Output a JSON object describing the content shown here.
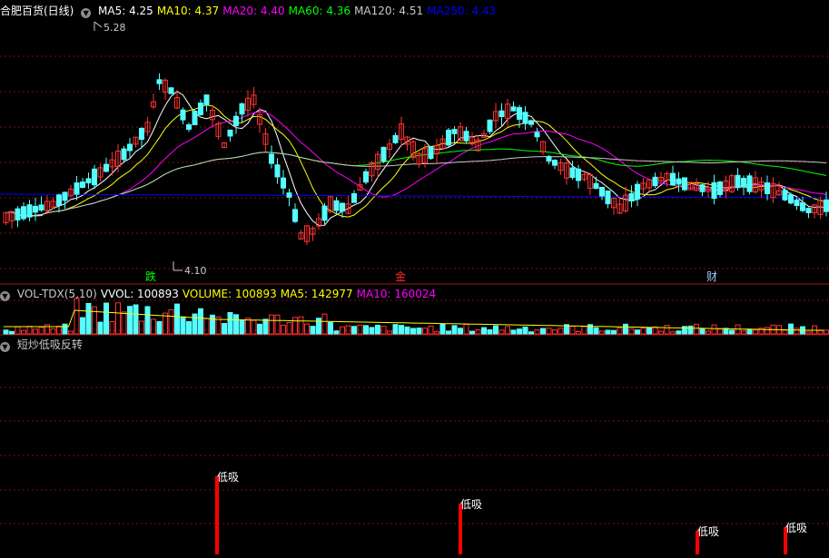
{
  "main_panel": {
    "stock_name": "合肥百货(日线)",
    "indicators": [
      {
        "label": "MA5: 4.25",
        "color": "#ffffff"
      },
      {
        "label": "MA10: 4.37",
        "color": "#ffff00"
      },
      {
        "label": "MA20: 4.40",
        "color": "#ff00ff"
      },
      {
        "label": "MA60: 4.36",
        "color": "#00ff00"
      },
      {
        "label": "MA120: 4.51",
        "color": "#c8c8c8"
      },
      {
        "label": "MA250: 4.43",
        "color": "#0000ff"
      }
    ],
    "high_label": "5.28",
    "low_label": "4.10",
    "markers": [
      {
        "text": "跌",
        "color": "#00ff00"
      },
      {
        "text": "金",
        "color": "#ff3030"
      },
      {
        "text": "财",
        "color": "#a0c8ff"
      }
    ]
  },
  "volume_panel": {
    "indicators": [
      {
        "label": "VOL-TDX(5,10)",
        "color": "#c8c8c8"
      },
      {
        "label": "VVOL: 100893",
        "color": "#ffffff"
      },
      {
        "label": "VOLUME: 100893",
        "color": "#ffff00"
      },
      {
        "label": "MA5: 142977",
        "color": "#ffff00"
      },
      {
        "label": "MA10: 160024",
        "color": "#ff00ff"
      }
    ]
  },
  "signal_panel": {
    "title": "短炒低吸反转",
    "signals": [
      {
        "label": "低吸",
        "strength": 1.0
      },
      {
        "label": "低吸",
        "strength": 0.65
      },
      {
        "label": "低吸",
        "strength": 0.3
      },
      {
        "label": "低吸",
        "strength": 0.35
      }
    ]
  },
  "colors": {
    "up": "#ff3232",
    "down": "#54ffff",
    "grid": "#7a1010",
    "signal": "#ff0000"
  }
}
